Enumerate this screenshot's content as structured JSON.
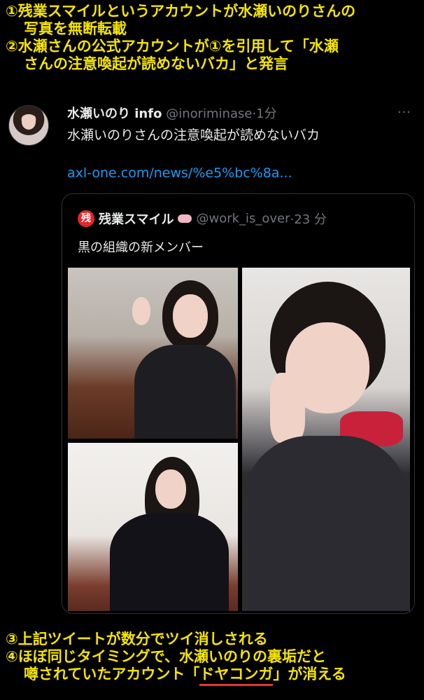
{
  "captions": {
    "top": [
      "①残業スマイルというアカウントが水瀬いのりさんの",
      "写真を無断転載",
      "②水瀬さんの公式アカウントが①を引用して「水瀬",
      "さんの注意喚起が読めないバカ」と発言"
    ],
    "bottom": {
      "line1": "③上記ツイートが数分でツイ消しされる",
      "line2": "④ほぼ同じタイミングで、水瀬いのりの裏垢だと",
      "line3_pre": "噂されていたアカウント「",
      "line3_highlight": "ドヤコンガ",
      "line3_post": "」が消える"
    }
  },
  "tweet": {
    "display_name": "水瀬いのり info",
    "handle": "@inoriminase",
    "time": "·1分",
    "more": "···",
    "text": "水瀬いのりさんの注意喚起が読めないバカ",
    "link": "axl-one.com/news/%e5%bc%8a...",
    "quote": {
      "badge": "残",
      "display_name": "残業スマイル",
      "handle": "@work_is_over",
      "time": "·23 分",
      "text": "黒の組織の新メンバー"
    }
  }
}
